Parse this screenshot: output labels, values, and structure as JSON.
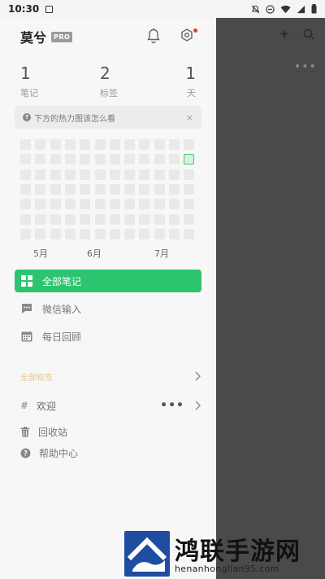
{
  "statusbar": {
    "time": "10:30"
  },
  "header": {
    "app_name": "莫兮",
    "badge": "PRO"
  },
  "stats": [
    {
      "value": "1",
      "label": "笔记"
    },
    {
      "value": "2",
      "label": "标签"
    },
    {
      "value": "1",
      "label": "天"
    }
  ],
  "tip": {
    "text": "下方的热力图该怎么看",
    "close": "×"
  },
  "heatmap": {
    "rows": 7,
    "cols": 12,
    "highlighted": [
      [
        1,
        11
      ]
    ]
  },
  "months": [
    "5月",
    "6月",
    "7月"
  ],
  "nav": [
    {
      "label": "全部笔记",
      "icon": "grid-icon",
      "active": true
    },
    {
      "label": "微信输入",
      "icon": "chat-icon",
      "active": false
    },
    {
      "label": "每日回顾",
      "icon": "calendar-icon",
      "active": false
    }
  ],
  "tags": {
    "title": "全部标签",
    "items": [
      {
        "name": "欢迎",
        "more": "•••"
      }
    ]
  },
  "utilities": [
    {
      "label": "回收站",
      "icon": "trash-icon"
    },
    {
      "label": "帮助中心",
      "icon": "help-icon"
    }
  ],
  "overlay": {
    "more": "•••"
  },
  "watermark": {
    "brand": "鸿联手游网",
    "url": "henanhonglian95.com"
  },
  "colors": {
    "accent": "#2dc46f",
    "overlay": "#4a4a4a",
    "badge_dot": "#e53935"
  }
}
